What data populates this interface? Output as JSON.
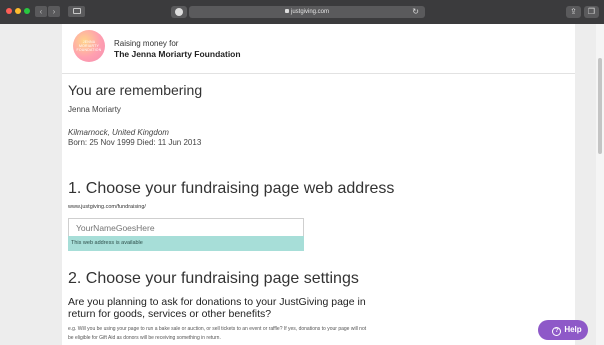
{
  "browser": {
    "url": "justgiving.com"
  },
  "header": {
    "logo_text": "JENNA MORIARTY FOUNDATION",
    "raising_label": "Raising money for",
    "charity_name": "The Jenna Moriarty Foundation"
  },
  "remembering": {
    "title": "You are remembering",
    "name": "Jenna Moriarty",
    "place": "Kilmarnock, United Kingdom",
    "dates": "Born: 25 Nov 1999 Died: 11 Jun 2013"
  },
  "step1": {
    "title": "1. Choose your fundraising page web address",
    "url_prefix": "www.justgiving.com/fundraising/",
    "input_placeholder": "YourNameGoesHere",
    "availability": "This web address is available"
  },
  "step2": {
    "title": "2. Choose your fundraising page settings",
    "question": "Are you planning to ask for donations to your JustGiving page in return for goods, services or other benefits?",
    "help_text": "e.g. Will you be using your page to run a bake sale or auction, or sell tickets to an event or raffle? If yes, donations to your page will not be eligible for Gift Aid as donors will be receiving something in return."
  },
  "help_button": {
    "label": "Help"
  }
}
